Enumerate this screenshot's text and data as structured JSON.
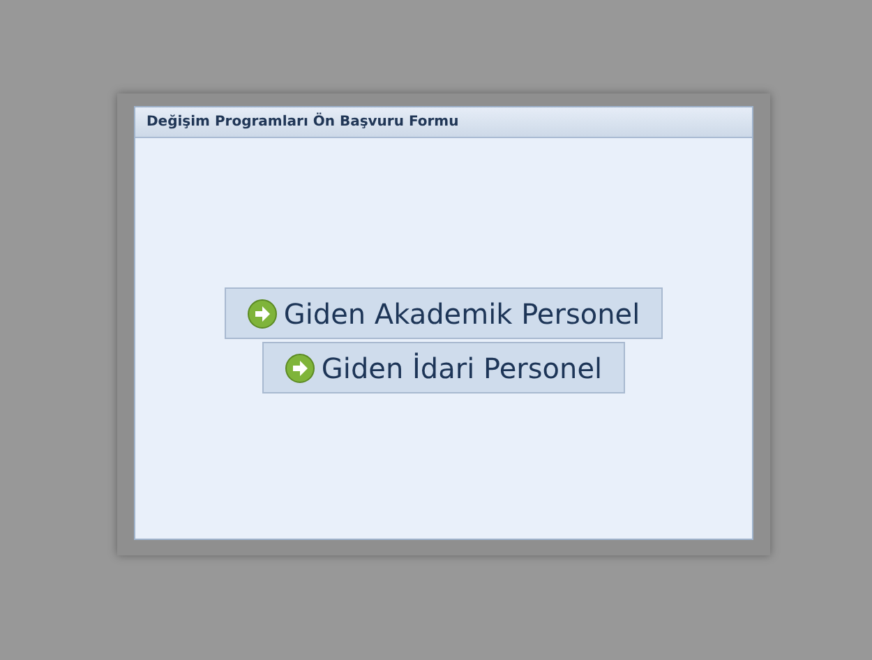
{
  "panel": {
    "title": "Değişim Programları Ön Başvuru Formu"
  },
  "buttons": [
    {
      "label": "Giden Akademik Personel"
    },
    {
      "label": "Giden İdari Personel"
    }
  ]
}
